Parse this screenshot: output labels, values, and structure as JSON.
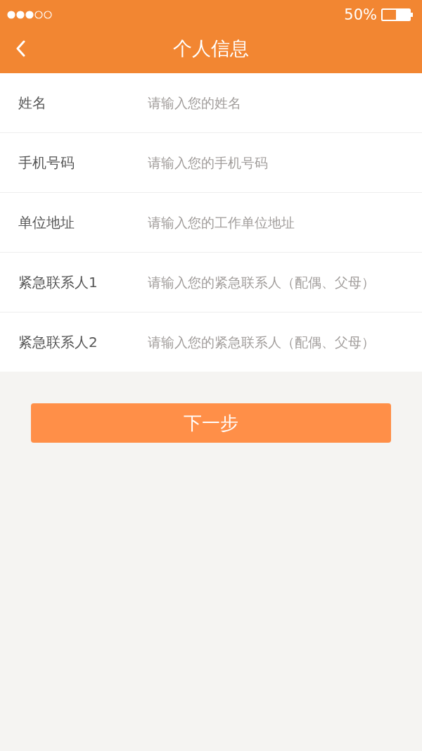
{
  "status_bar": {
    "battery": "50%"
  },
  "nav": {
    "title": "个人信息"
  },
  "fields": [
    {
      "label": "姓名",
      "placeholder": "请输入您的姓名"
    },
    {
      "label": "手机号码",
      "placeholder": "请输入您的手机号码"
    },
    {
      "label": "单位地址",
      "placeholder": "请输入您的工作单位地址"
    },
    {
      "label": "紧急联系人1",
      "placeholder": "请输入您的紧急联系人（配偶、父母）"
    },
    {
      "label": "紧急联系人2",
      "placeholder": "请输入您的紧急联系人（配偶、父母）"
    }
  ],
  "next_button": {
    "label": "下一步"
  }
}
